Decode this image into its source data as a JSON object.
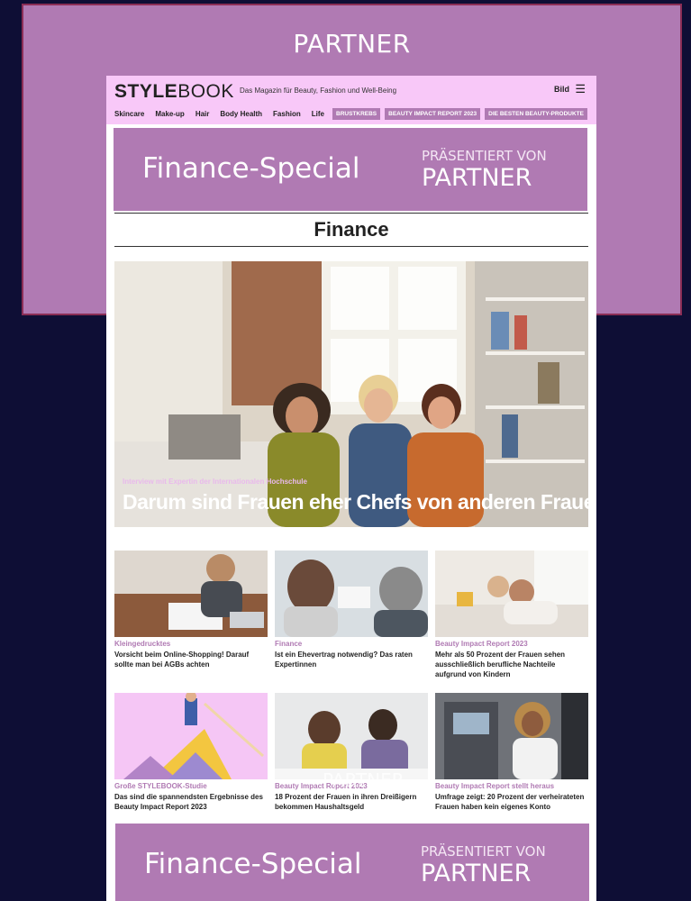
{
  "banner": {
    "label": "PARTNER"
  },
  "header": {
    "logo_bold": "STYLE",
    "logo_light": "BOOK",
    "tagline": "Das Magazin für Beauty, Fashion und Well-Being",
    "partner_mark": "Bild",
    "menu_icon": "hamburger-icon"
  },
  "nav": {
    "items": [
      "Skincare",
      "Make-up",
      "Hair",
      "Body Health",
      "Fashion",
      "Life"
    ],
    "pills": [
      "BRUSTKREBS",
      "BEAUTY IMPACT REPORT 2023",
      "DIE BESTEN BEAUTY-PRODUKTE"
    ]
  },
  "special_top": {
    "title": "Finance-Special",
    "presented_by": "PRÄSENTIERT VON",
    "partner": "PARTNER"
  },
  "section": {
    "title": "Finance"
  },
  "hero": {
    "category": "Interview mit Expertin der Internationalen Hochschule",
    "headline": "Darum sind Frauen eher Chefs von anderen Frauen"
  },
  "articles": [
    {
      "category": "Kleingedrucktes",
      "title": "Vorsicht beim Online-Shopping! Darauf sollte man bei AGBs achten"
    },
    {
      "category": "Finance",
      "title": "Ist ein Ehevertrag notwendig? Das raten Expertinnen"
    },
    {
      "category": "Beauty Impact Report 2023",
      "title": "Mehr als 50 Prozent der Frauen sehen ausschließlich berufliche Nachteile aufgrund von Kindern"
    },
    {
      "category": "Große STYLEBOOK-Studie",
      "title": "Das sind die spannendsten Ergebnisse des Beauty Impact Report 2023"
    },
    {
      "category": "Beauty Impact Report 2023",
      "title": "18 Prozent der Frauen in ihren Dreißigern bekommen Haushaltsgeld"
    },
    {
      "category": "Beauty Impact Report stellt heraus",
      "title": "Umfrage zeigt: 20 Prozent der verheirateten Frauen haben kein eigenes Konto"
    }
  ],
  "overlay": {
    "label": "PARTNER"
  },
  "special_bottom": {
    "title": "Finance-Special",
    "presented_by": "PRÄSENTIERT VON",
    "partner": "PARTNER"
  },
  "colors": {
    "background": "#0e0e35",
    "accent": "#b07ab3",
    "header": "#f8c8f8",
    "border": "#8a2d55"
  }
}
